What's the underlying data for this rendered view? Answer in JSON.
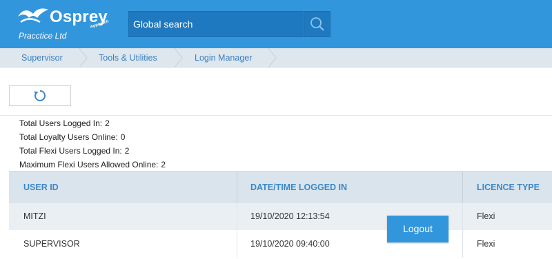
{
  "header": {
    "brand_name": "Osprey",
    "brand_tagline": "Approach",
    "company": "Pracctice Ltd",
    "search_placeholder": "Global search",
    "search_icon": "search-icon",
    "bird_logo": "osprey-bird-logo",
    "colors": {
      "header": "#3296dc",
      "accent": "#3a87c9",
      "search_bg": "#1e79c0"
    }
  },
  "breadcrumb": {
    "items": [
      {
        "label": "Supervisor"
      },
      {
        "label": "Tools & Utilities"
      },
      {
        "label": "Login Manager"
      }
    ]
  },
  "toolbar": {
    "refresh_icon": "refresh-icon"
  },
  "stats": [
    {
      "label": "Total Users Logged In:",
      "value": "2"
    },
    {
      "label": "Total Loyalty Users Online:",
      "value": "0"
    },
    {
      "label": "Total Flexi Users Logged In:",
      "value": "2"
    },
    {
      "label": "Maximum Flexi Users Allowed Online:",
      "value": "2"
    }
  ],
  "table": {
    "columns": [
      "USER ID",
      "DATE/TIME LOGGED IN",
      "LICENCE TYPE"
    ],
    "rows": [
      [
        "MITZI",
        "19/10/2020 12:13:54",
        "Flexi"
      ],
      [
        "SUPERVISOR",
        "19/10/2020 09:40:00",
        "Flexi"
      ]
    ]
  },
  "actions": {
    "logout_label": "Logout"
  }
}
